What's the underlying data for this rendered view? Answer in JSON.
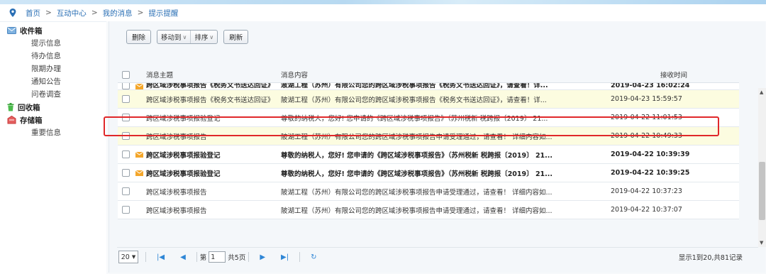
{
  "breadcrumb": {
    "items": [
      "首页",
      "互动中心",
      "我的消息",
      "提示提醒"
    ],
    "sep": ">"
  },
  "sidebar": {
    "inbox": {
      "label": "收件箱",
      "items": [
        "提示信息",
        "待办信息",
        "限期办理",
        "通知公告",
        "问卷调查"
      ]
    },
    "recycle": {
      "label": "回收箱"
    },
    "archive": {
      "label": "存储箱",
      "items": [
        "重要信息"
      ]
    }
  },
  "toolbar": {
    "delete": "删除",
    "move": "移动到",
    "sort": "排序",
    "refresh": "刷新"
  },
  "table": {
    "headers": {
      "subject": "消息主题",
      "body": "消息内容",
      "time": "接收时间"
    },
    "partial_row": {
      "subject": "跨区域涉税事项报告《税务文书送达回证》",
      "body": "淑湖工程（苏州）有限公司您的跨区域涉税事项报告《税务文书送达回证》，请查看！详...",
      "time": "2019-04-23 16:02:24"
    },
    "rows": [
      {
        "subject": "跨区域涉税事项报告《税务文书送达回证》",
        "body": "陂湖工程（苏州）有限公司您的跨区域涉税事项报告《税务文书送达回证》，请查看！详...",
        "time": "2019-04-23 15:59:57",
        "alt": true,
        "bold": false,
        "envelope": false
      },
      {
        "subject": "跨区域涉税事项报验登记",
        "body": "尊敬的纳税人，您好! 您申请的《跨区域涉税事项报告》（苏州税新 税跨报〔2019〕 21...",
        "time": "2019-04-22 11:01:53",
        "alt": false,
        "bold": false,
        "envelope": false
      },
      {
        "subject": "跨区域涉税事项报告",
        "body": "陂湖工程（苏州）有限公司您的跨区域涉税事项报告申请受理通过，请查看！ 详细内容如...",
        "time": "2019-04-22 10:49:33",
        "alt": true,
        "bold": false,
        "envelope": false
      },
      {
        "subject": "跨区域涉税事项报验登记",
        "body": "尊敬的纳税人，您好! 您申请的《跨区域涉税事项报告》（苏州税新 税跨报〔2019〕 21...",
        "time": "2019-04-22 10:39:39",
        "alt": false,
        "bold": true,
        "envelope": true
      },
      {
        "subject": "跨区域涉税事项报验登记",
        "body": "尊敬的纳税人，您好! 您申请的《跨区域涉税事项报告》（苏州税新 税跨报〔2019〕 21...",
        "time": "2019-04-22 10:39:25",
        "alt": false,
        "bold": true,
        "envelope": true
      },
      {
        "subject": "跨区域涉税事项报告",
        "body": "陂湖工程（苏州）有限公司您的跨区域涉税事项报告申请受理通过，请查看！ 详细内容如...",
        "time": "2019-04-22 10:37:23",
        "alt": false,
        "bold": false,
        "envelope": false
      },
      {
        "subject": "跨区域涉税事项报告",
        "body": "陂湖工程（苏州）有限公司您的跨区域涉税事项报告申请受理通过，请查看！ 详细内容如...",
        "time": "2019-04-22 10:37:07",
        "alt": false,
        "bold": false,
        "envelope": false
      }
    ]
  },
  "pager": {
    "page_size": "20",
    "page_prefix": "第",
    "page_value": "1",
    "page_suffix": "共5页",
    "summary": "显示1到20,共81记录"
  },
  "colors": {
    "link": "#2a6fb5",
    "row_alt": "#fcfce0",
    "highlight": "#e0282a",
    "pager_icon": "#2e86d6"
  },
  "icons": {
    "location": "location-pin-icon",
    "inbox": "envelope-icon",
    "recycle": "trash-icon",
    "archive": "archive-box-icon",
    "unread": "unread-envelope-icon"
  }
}
